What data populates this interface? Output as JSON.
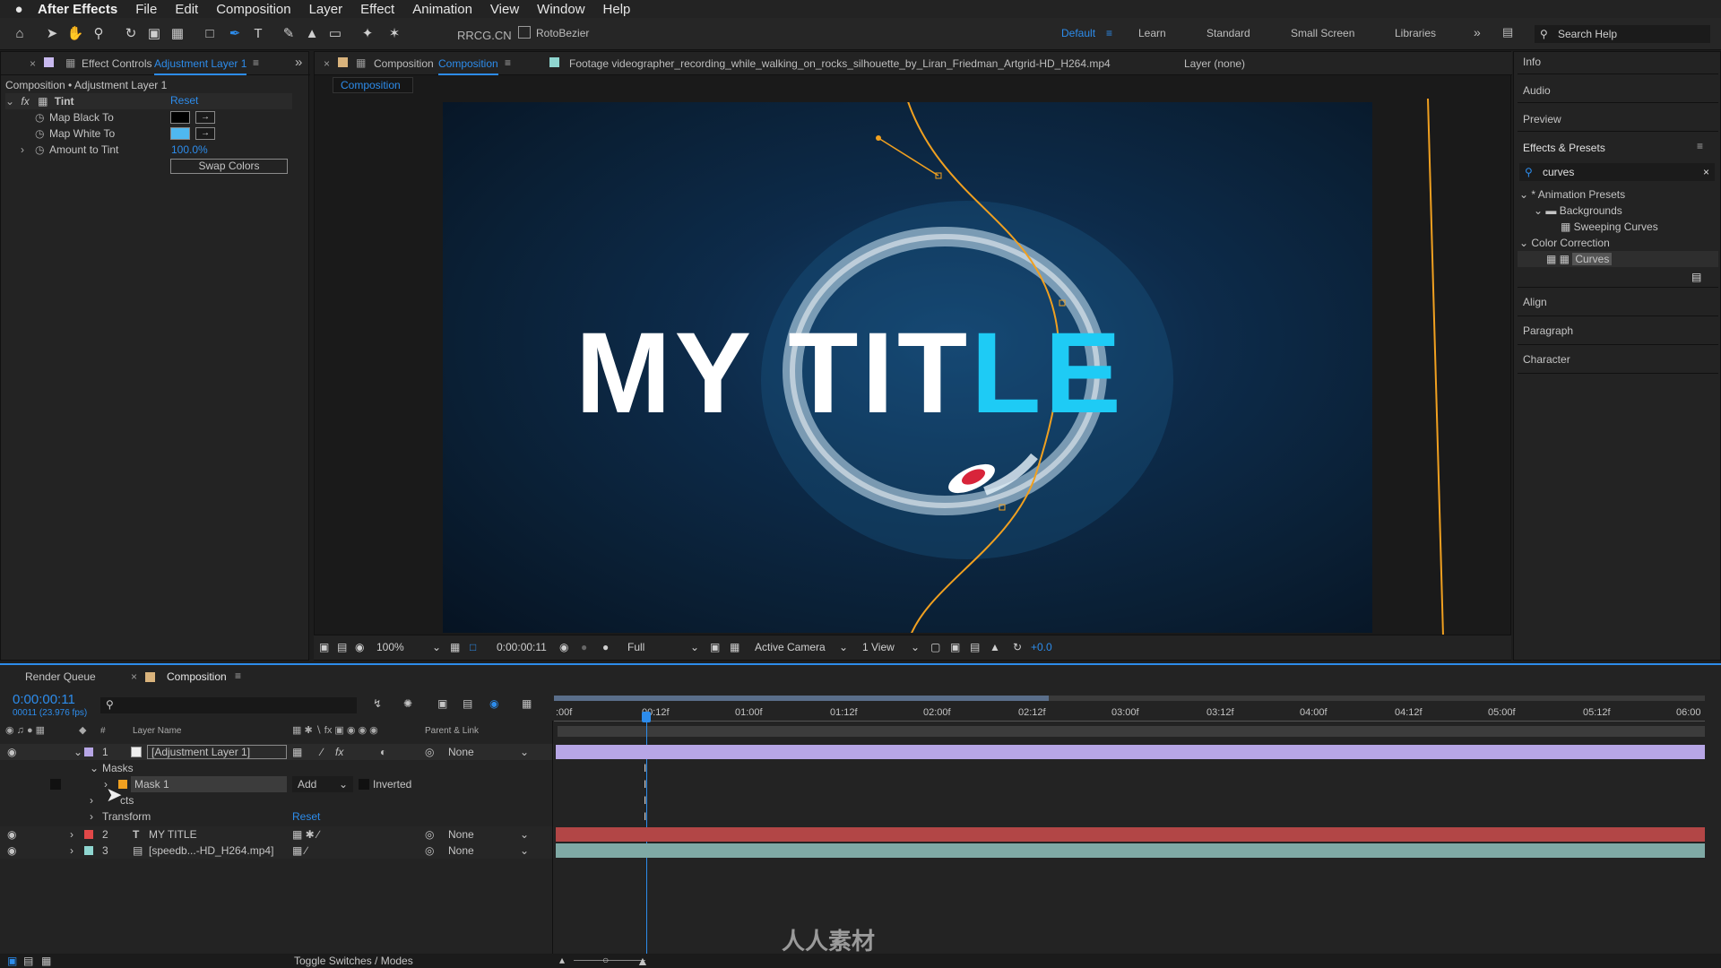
{
  "menubar": {
    "app": "After Effects",
    "items": [
      "File",
      "Edit",
      "Composition",
      "Layer",
      "Effect",
      "Animation",
      "View",
      "Window",
      "Help"
    ]
  },
  "toolbar": {
    "rotobezier_label": "RotoBezier",
    "workspaces": [
      "Default",
      "Learn",
      "Standard",
      "Small Screen",
      "Libraries"
    ],
    "search_placeholder": "Search Help",
    "watermark": "RRCG.CN"
  },
  "effect_controls": {
    "tab_label": "Effect Controls",
    "tab_layer": "Adjustment Layer 1",
    "breadcrumb": "Composition • Adjustment Layer 1",
    "effect_name": "Tint",
    "reset_label": "Reset",
    "props": [
      {
        "label": "Map Black To",
        "color": "#000000"
      },
      {
        "label": "Map White To",
        "color": "#4fb8f0"
      },
      {
        "label": "Amount to Tint",
        "value": "100.0%"
      }
    ],
    "swap_label": "Swap Colors"
  },
  "composition_panel": {
    "tab_label": "Composition",
    "tab_name": "Composition",
    "footage_tab": "Footage videographer_recording_while_walking_on_rocks_silhouette_by_Liran_Friedman_Artgrid-HD_H264.mp4",
    "layer_tab": "Layer (none)",
    "comp_chip": "Composition",
    "title_white": "MY TIT",
    "title_cyan": "LE",
    "viewer_bar": {
      "zoom": "100%",
      "timecode": "0:00:00:11",
      "resolution": "Full",
      "camera": "Active Camera",
      "views": "1 View",
      "exposure": "+0.0"
    }
  },
  "right_panel": {
    "items_top": [
      "Info",
      "Audio",
      "Preview",
      "Effects & Presets"
    ],
    "search_value": "curves",
    "tree": [
      {
        "label": "* Animation Presets",
        "level": 0
      },
      {
        "label": "Backgrounds",
        "level": 1
      },
      {
        "label": "Sweeping Curves",
        "level": 2
      },
      {
        "label": "Color Correction",
        "level": 0
      },
      {
        "label": "Curves",
        "level": 2
      }
    ],
    "items_bottom": [
      "Align",
      "Paragraph",
      "Character"
    ]
  },
  "timeline": {
    "render_queue": "Render Queue",
    "comp_tab": "Composition",
    "timecode": "0:00:00:11",
    "frames": "00011 (23.976 fps)",
    "col_layer_name": "Layer Name",
    "col_parent": "Parent & Link",
    "col_num": "#",
    "ticks": [
      ":00f",
      "00:12f",
      "01:00f",
      "01:12f",
      "02:00f",
      "02:12f",
      "03:00f",
      "03:12f",
      "04:00f",
      "04:12f",
      "05:00f",
      "05:12f",
      "06:00"
    ],
    "layers": [
      {
        "num": "1",
        "name": "[Adjustment Layer 1]",
        "parent": "None",
        "color": "#b7a6e6"
      },
      {
        "num": "2",
        "name": "MY TITLE",
        "parent": "None",
        "color": "#e04848"
      },
      {
        "num": "3",
        "name": "[speedb...-HD_H264.mp4]",
        "parent": "None",
        "color": "#8fd6d0"
      }
    ],
    "masks_label": "Masks",
    "mask_name": "Mask 1",
    "mask_mode": "Add",
    "inverted_label": "Inverted",
    "effects_label": "cts",
    "transform_label": "Transform",
    "reset_label": "Reset",
    "toggle_label": "Toggle Switches / Modes",
    "logo_text": "人人素材"
  }
}
